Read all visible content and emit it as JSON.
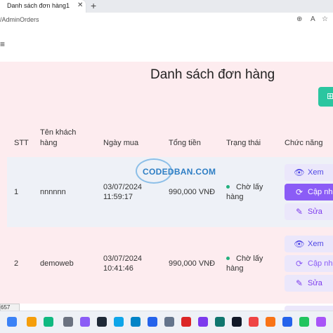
{
  "browser": {
    "tab_title": "Danh sách đơn hàng1",
    "tab_close": "✕",
    "new_tab": "+",
    "url": "/AdminOrders",
    "zoom_icon": "⊕",
    "read_aloud_icon": "A",
    "favorite_icon": "☆",
    "extension_icon": "▭"
  },
  "header": {
    "menu_icon": "≡"
  },
  "page": {
    "title": "Danh sách đơn hàng",
    "add_icon": "⊞"
  },
  "table": {
    "headers": {
      "stt": "STT",
      "customer": "Tên khách hàng",
      "date": "Ngày mua",
      "total": "Tổng tiền",
      "status": "Trạng thái",
      "actions": "Chức năng"
    },
    "rows": [
      {
        "stt": "1",
        "customer": "nnnnnn",
        "date": "03/07/2024",
        "time": "11:59:17",
        "total": "990,000 VNĐ",
        "status": "Chờ lấy hàng",
        "actions": {
          "view": "Xem",
          "update": "Cập nhật",
          "edit": "Sửa"
        }
      },
      {
        "stt": "2",
        "customer": "demoweb",
        "date": "03/07/2024",
        "time": "10:41:46",
        "total": "990,000 VNĐ",
        "status": "Chờ lấy hàng",
        "actions": {
          "view": "Xem",
          "update": "Cập nhật",
          "edit": "Sửa"
        }
      }
    ]
  },
  "watermark": "CODEDBAN.COM",
  "status_bar": "657",
  "colors": {
    "page_bg": "#fdecef",
    "accent_green": "#2bc6a0",
    "purple": "#8b5cf6",
    "status_dot": "#22b07d"
  }
}
